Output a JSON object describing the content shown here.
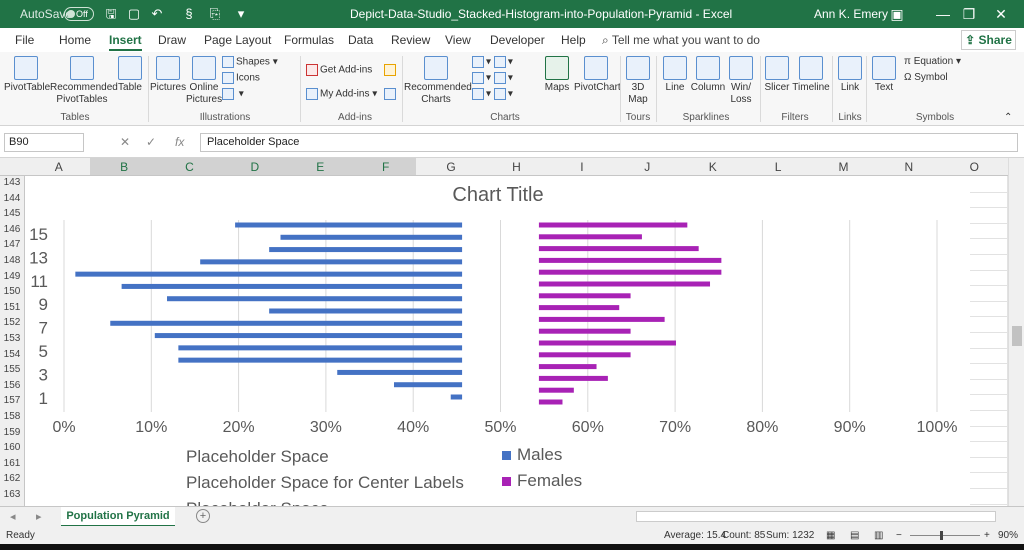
{
  "titlebar": {
    "autosave_label": "AutoSave",
    "autosave_state": "Off",
    "doc_title": "Depict-Data-Studio_Stacked-Histogram-into-Population-Pyramid  -  Excel",
    "user": "Ann K. Emery"
  },
  "tabs": [
    "File",
    "Home",
    "Insert",
    "Draw",
    "Page Layout",
    "Formulas",
    "Data",
    "Review",
    "View",
    "Developer",
    "Help"
  ],
  "active_tab": "Insert",
  "tell_me": "Tell me what you want to do",
  "share_label": "Share",
  "ribbon": {
    "buttons": {
      "pivottable": "PivotTable",
      "recommended_pivottables": "Recommended\nPivotTables",
      "table": "Table",
      "pictures": "Pictures",
      "online_pictures": "Online\nPictures",
      "shapes": "Shapes",
      "icons": "Icons",
      "get_addins": "Get Add-ins",
      "my_addins": "My Add-ins",
      "recommended_charts": "Recommended\nCharts",
      "maps": "Maps",
      "pivotchart": "PivotChart",
      "map3d": "3D\nMap",
      "line": "Line",
      "column": "Column",
      "winloss": "Win/\nLoss",
      "slicer": "Slicer",
      "timeline": "Timeline",
      "link": "Link",
      "text": "Text",
      "equation": "Equation",
      "symbol": "Symbol"
    },
    "groups": {
      "tables": "Tables",
      "illustrations": "Illustrations",
      "addins": "Add-ins",
      "charts": "Charts",
      "tours": "Tours",
      "sparklines": "Sparklines",
      "filters": "Filters",
      "links": "Links",
      "symbols": "Symbols"
    }
  },
  "formula_bar": {
    "name_box": "B90",
    "fx": "fx",
    "content": "Placeholder Space"
  },
  "columns": [
    "A",
    "B",
    "C",
    "D",
    "E",
    "F",
    "G",
    "H",
    "I",
    "J",
    "K",
    "L",
    "M",
    "N",
    "O"
  ],
  "rows": [
    "143",
    "144",
    "145",
    "146",
    "147",
    "148",
    "149",
    "150",
    "151",
    "152",
    "153",
    "154",
    "155",
    "156",
    "157",
    "158",
    "159",
    "160",
    "161",
    "162",
    "163"
  ],
  "chart_data": {
    "type": "bar",
    "title": "Chart Title",
    "x_ticks": [
      "0%",
      "10%",
      "20%",
      "30%",
      "40%",
      "50%",
      "60%",
      "70%",
      "80%",
      "90%",
      "100%"
    ],
    "y_labels": [
      "15",
      "13",
      "11",
      "9",
      "7",
      "5",
      "3",
      "1"
    ],
    "xlim": [
      0,
      100
    ],
    "series": [
      {
        "name": "Males",
        "color": "#4472c4",
        "start": [
          19.6,
          24.8,
          23.5,
          15.6,
          1.3,
          6.6,
          11.8,
          23.5,
          5.3,
          10.4,
          13.1,
          13.1,
          31.3,
          37.8,
          44.3
        ],
        "end": 45.6
      },
      {
        "name": "Females",
        "color": "#a822b5",
        "start": 54.4,
        "end": [
          71.4,
          66.2,
          72.7,
          75.3,
          75.3,
          74.0,
          64.9,
          63.6,
          68.8,
          64.9,
          70.1,
          64.9,
          61.0,
          62.3,
          58.4,
          57.1
        ]
      }
    ],
    "legend_left": [
      "Placeholder Space",
      "Placeholder Space for Center Labels",
      "Placeholder Space"
    ]
  },
  "sheet_tab": "Population Pyramid",
  "status": {
    "ready": "Ready",
    "average": "Average: 15.4",
    "count": "Count: 85",
    "sum": "Sum: 1232",
    "zoom": "90%"
  }
}
